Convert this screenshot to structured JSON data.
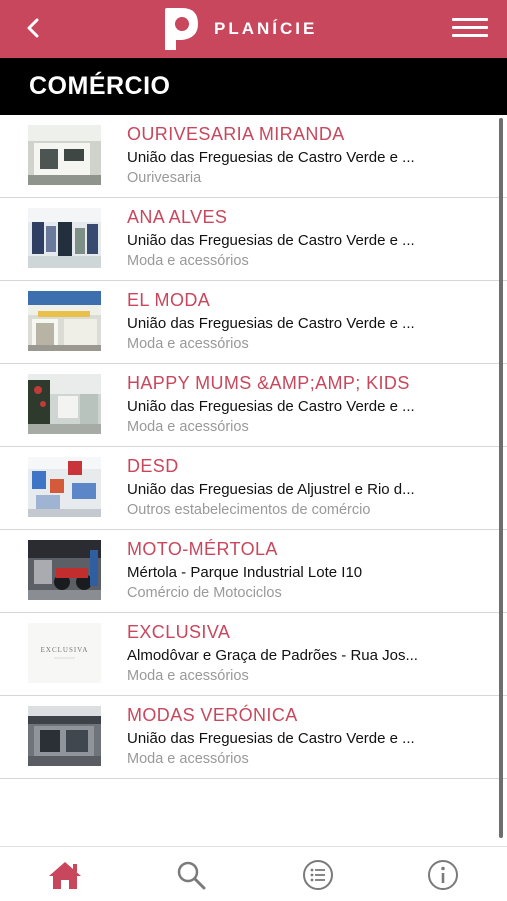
{
  "app": {
    "brand": "PLANÍCIE",
    "accent_color": "#c9475c"
  },
  "header": {
    "back_icon": "chevron-left-icon",
    "menu_icon": "hamburger-menu-icon"
  },
  "section": {
    "title": "COMÉRCIO"
  },
  "items": [
    {
      "name": "OURIVESARIA MIRANDA",
      "address": "União das Freguesias de Castro Verde e ...",
      "category": "Ourivesaria"
    },
    {
      "name": "ANA ALVES",
      "address": "União das Freguesias de Castro Verde e ...",
      "category": "Moda e acessórios"
    },
    {
      "name": "EL MODA",
      "address": "União das Freguesias de Castro Verde e ...",
      "category": "Moda e acessórios"
    },
    {
      "name": "HAPPY MUMS &AMP;AMP; KIDS",
      "address": "União das Freguesias de Castro Verde e ...",
      "category": "Moda e acessórios"
    },
    {
      "name": "DESD",
      "address": "União das Freguesias de Aljustrel e Rio d...",
      "category": "Outros estabelecimentos de comércio"
    },
    {
      "name": "MOTO-MÉRTOLA",
      "address": "Mértola - Parque Industrial Lote I10",
      "category": "Comércio de Motociclos"
    },
    {
      "name": "EXCLUSIVA",
      "address": "Almodôvar e Graça de Padrões - Rua Jos...",
      "category": "Moda e acessórios",
      "thumb_text": "EXCLUSIVA"
    },
    {
      "name": "MODAS VERÓNICA",
      "address": "União das Freguesias de Castro Verde e ...",
      "category": "Moda e acessórios"
    }
  ],
  "bottom_nav": [
    {
      "icon": "home-icon",
      "active": true
    },
    {
      "icon": "search-icon",
      "active": false
    },
    {
      "icon": "list-icon",
      "active": false
    },
    {
      "icon": "info-icon",
      "active": false
    }
  ]
}
